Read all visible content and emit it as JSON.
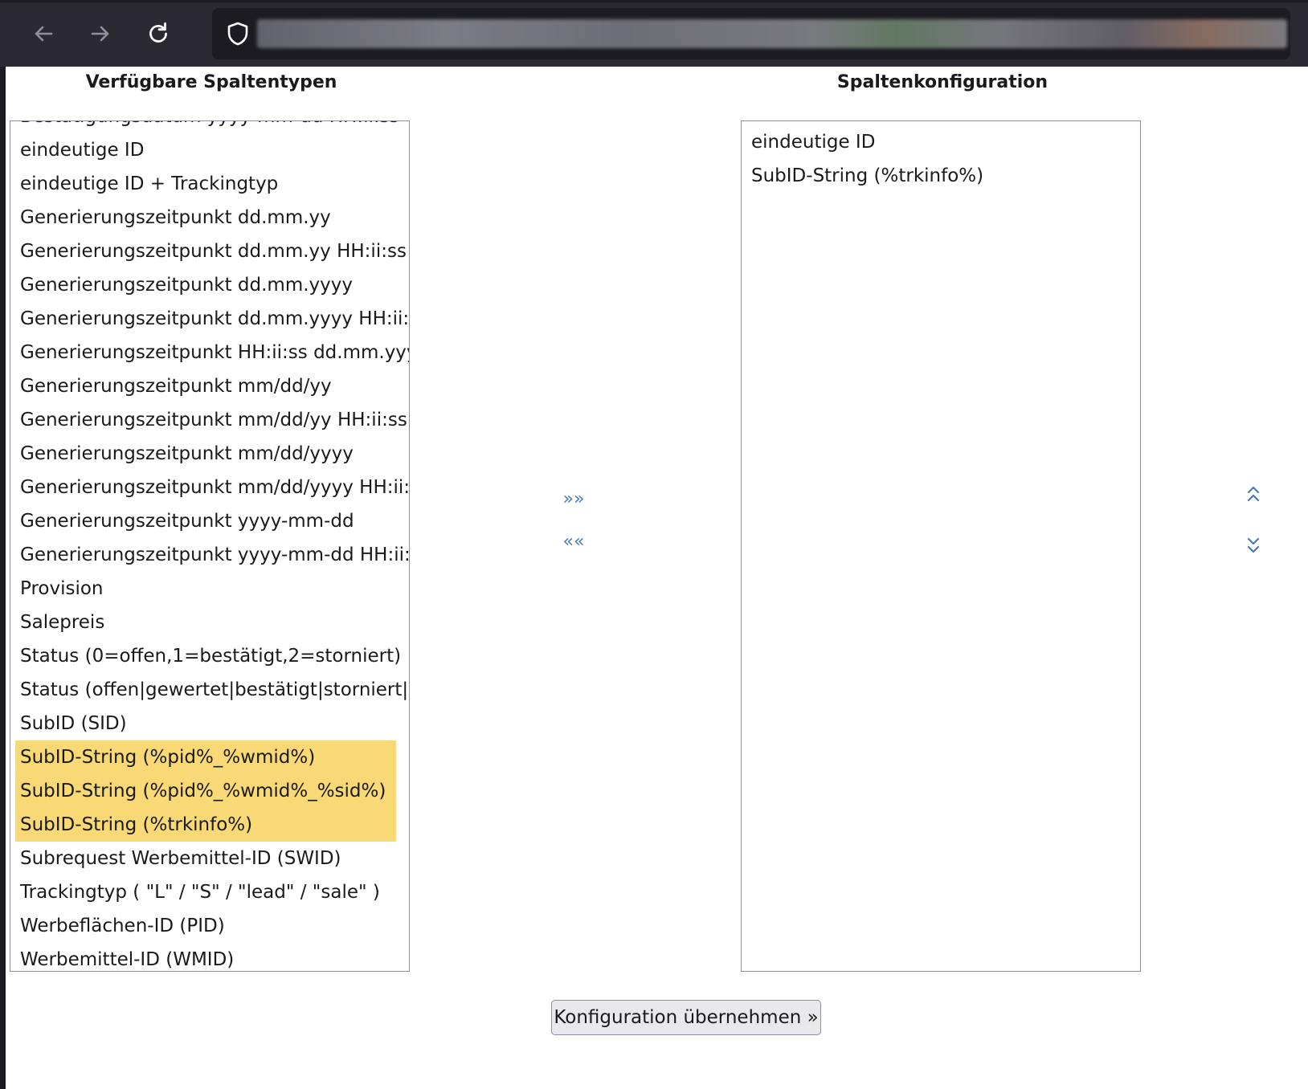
{
  "browser": {
    "back_icon": "arrow-left-icon",
    "forward_icon": "arrow-right-icon",
    "reload_icon": "reload-icon",
    "shield_icon": "shield-icon"
  },
  "left_panel": {
    "title": "Verfügbare Spaltentypen",
    "items": [
      {
        "label": "Bestätigungsdatum yyyy-mm-dd HH:ii:ss",
        "selected": false
      },
      {
        "label": "eindeutige ID",
        "selected": false
      },
      {
        "label": "eindeutige ID + Trackingtyp",
        "selected": false
      },
      {
        "label": "Generierungszeitpunkt dd.mm.yy",
        "selected": false
      },
      {
        "label": "Generierungszeitpunkt dd.mm.yy HH:ii:ss",
        "selected": false
      },
      {
        "label": "Generierungszeitpunkt dd.mm.yyyy",
        "selected": false
      },
      {
        "label": "Generierungszeitpunkt dd.mm.yyyy HH:ii:ss",
        "selected": false
      },
      {
        "label": "Generierungszeitpunkt HH:ii:ss dd.mm.yyyy",
        "selected": false
      },
      {
        "label": "Generierungszeitpunkt mm/dd/yy",
        "selected": false
      },
      {
        "label": "Generierungszeitpunkt mm/dd/yy HH:ii:ss",
        "selected": false
      },
      {
        "label": "Generierungszeitpunkt mm/dd/yyyy",
        "selected": false
      },
      {
        "label": "Generierungszeitpunkt mm/dd/yyyy HH:ii:ss",
        "selected": false
      },
      {
        "label": "Generierungszeitpunkt yyyy-mm-dd",
        "selected": false
      },
      {
        "label": "Generierungszeitpunkt yyyy-mm-dd HH:ii:ss",
        "selected": false
      },
      {
        "label": "Provision",
        "selected": false
      },
      {
        "label": "Salepreis",
        "selected": false
      },
      {
        "label": "Status (0=offen,1=bestätigt,2=storniert)",
        "selected": false
      },
      {
        "label": "Status (offen|gewertet|bestätigt|storniert|a",
        "selected": false
      },
      {
        "label": "SubID (SID)",
        "selected": false
      },
      {
        "label": "SubID-String (%pid%_%wmid%)",
        "selected": true
      },
      {
        "label": "SubID-String (%pid%_%wmid%_%sid%)",
        "selected": true
      },
      {
        "label": "SubID-String (%trkinfo%)",
        "selected": true
      },
      {
        "label": "Subrequest Werbemittel-ID (SWID)",
        "selected": false
      },
      {
        "label": "Trackingtyp ( \"L\" / \"S\" / \"lead\" / \"sale\" )",
        "selected": false
      },
      {
        "label": "Werbeflächen-ID (PID)",
        "selected": false
      },
      {
        "label": "Werbemittel-ID (WMID)",
        "selected": false
      }
    ]
  },
  "right_panel": {
    "title": "Spaltenkonfiguration",
    "items": [
      {
        "label": "eindeutige ID",
        "selected": false
      },
      {
        "label": "SubID-String (%trkinfo%)",
        "selected": false
      }
    ]
  },
  "transfer": {
    "add_label": "»»",
    "remove_label": "««",
    "add_icon": "double-chevron-right-icon",
    "remove_icon": "double-chevron-left-icon"
  },
  "reorder": {
    "up_icon": "double-chevron-up-icon",
    "down_icon": "double-chevron-down-icon"
  },
  "submit_label": "Konfiguration übernehmen »",
  "colors": {
    "selection": "#f9d976",
    "toolbar": "#2b2a33",
    "arrow": "#4a7ab8"
  }
}
